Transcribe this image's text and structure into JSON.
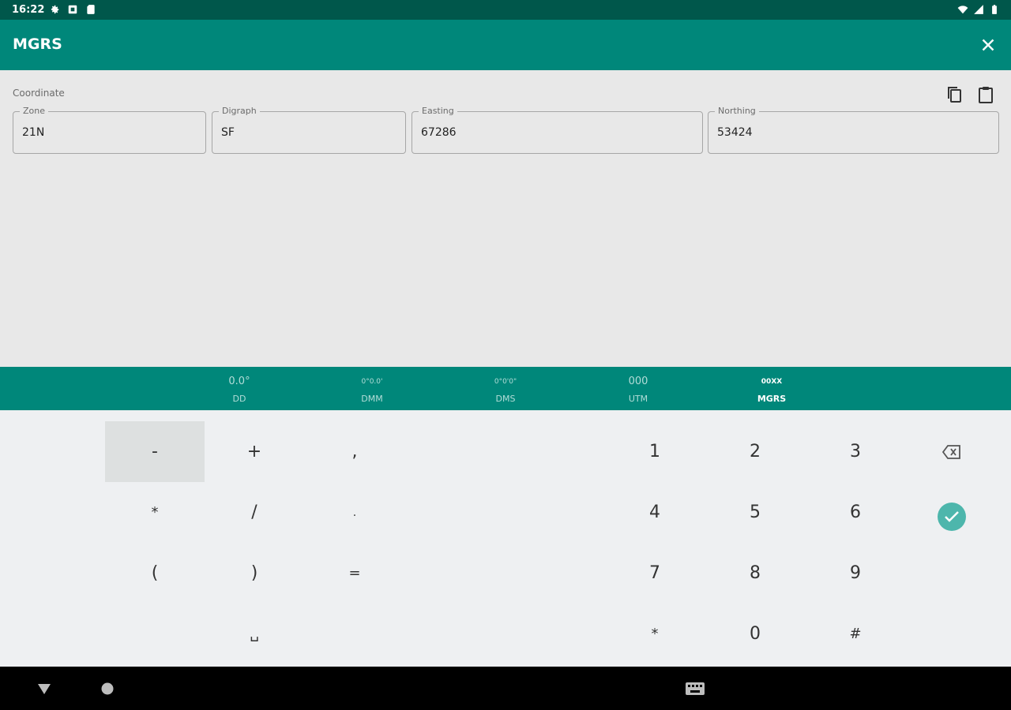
{
  "status": {
    "time": "16:22"
  },
  "appbar": {
    "title": "MGRS"
  },
  "coordinate": {
    "label": "Coordinate",
    "fields": [
      {
        "label": "Zone",
        "value": "21N"
      },
      {
        "label": "Digraph",
        "value": "SF"
      },
      {
        "label": "Easting",
        "value": "67286"
      },
      {
        "label": "Northing",
        "value": "53424"
      }
    ]
  },
  "formats": [
    {
      "sample": "0.0°",
      "name": "DD"
    },
    {
      "sample": "0°0.0'",
      "name": "DMM"
    },
    {
      "sample": "0°0'0\"",
      "name": "DMS"
    },
    {
      "sample": "000",
      "name": "UTM"
    },
    {
      "sample": "00XX",
      "name": "MGRS"
    }
  ],
  "keypad": {
    "symbols": [
      "-",
      "+",
      ",",
      "*",
      "/",
      ".",
      "(",
      ")",
      "=",
      "␣"
    ],
    "digits": [
      "1",
      "2",
      "3",
      "4",
      "5",
      "6",
      "7",
      "8",
      "9",
      "*",
      "0",
      "#"
    ]
  },
  "colors": {
    "primary": "#00877a",
    "primary_dark": "#00574b",
    "accent": "#4db6ac",
    "keypad_bg": "#eef0f2"
  },
  "icons": [
    "settings-icon",
    "notification-icon",
    "sd-card-icon",
    "wifi-icon",
    "signal-icon",
    "battery-icon",
    "close-icon",
    "copy-icon",
    "clipboard-icon",
    "backspace-icon",
    "check-circle-icon",
    "back-triangle-icon",
    "home-circle-icon",
    "keyboard-icon"
  ]
}
